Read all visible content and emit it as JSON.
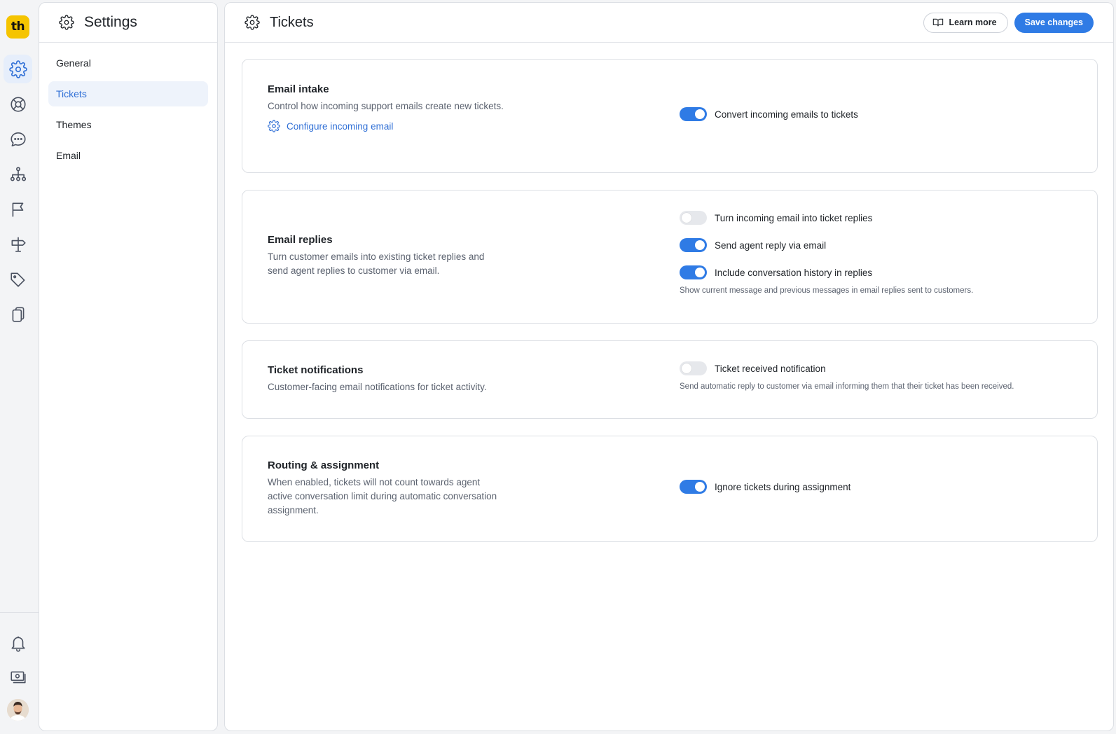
{
  "brand": {
    "logo_text": "th",
    "accent": "#2f7be5",
    "logo_color": "#f5c400"
  },
  "rail": {
    "items": [
      {
        "name": "settings-icon",
        "active": true
      },
      {
        "name": "lifebuoy-icon",
        "active": false
      },
      {
        "name": "chat-icon",
        "active": false
      },
      {
        "name": "org-chart-icon",
        "active": false
      },
      {
        "name": "flag-icon",
        "active": false
      },
      {
        "name": "signpost-icon",
        "active": false
      },
      {
        "name": "tag-icon",
        "active": false
      },
      {
        "name": "pages-icon",
        "active": false
      }
    ],
    "bottom": [
      "bell-icon",
      "billing-icon",
      "avatar"
    ]
  },
  "subnav": {
    "title": "Settings",
    "items": [
      {
        "label": "General",
        "active": false
      },
      {
        "label": "Tickets",
        "active": true
      },
      {
        "label": "Themes",
        "active": false
      },
      {
        "label": "Email",
        "active": false
      }
    ]
  },
  "main": {
    "title": "Tickets",
    "learn_more_label": "Learn more",
    "save_label": "Save changes"
  },
  "sections": {
    "email_intake": {
      "title": "Email intake",
      "description": "Control how incoming support emails create new tickets.",
      "link_label": "Configure incoming email",
      "toggles": [
        {
          "label": "Convert incoming emails to tickets",
          "on": true
        }
      ]
    },
    "email_replies": {
      "title": "Email replies",
      "description": "Turn customer emails into existing ticket replies and send agent replies to customer via email.",
      "toggles": [
        {
          "label": "Turn incoming email into ticket replies",
          "on": false
        },
        {
          "label": "Send agent reply via email",
          "on": true
        },
        {
          "label": "Include conversation history in replies",
          "on": true
        }
      ],
      "help": "Show current message and previous messages in email replies sent to customers."
    },
    "ticket_notifications": {
      "title": "Ticket notifications",
      "description": "Customer-facing email notifications for ticket activity.",
      "toggles": [
        {
          "label": "Ticket received notification",
          "on": false
        }
      ],
      "help": "Send automatic reply to customer via email informing them that their ticket has been received."
    },
    "routing": {
      "title": "Routing & assignment",
      "description": "When enabled, tickets will not count towards agent active conversation limit during automatic conversation assignment.",
      "toggles": [
        {
          "label": "Ignore tickets during assignment",
          "on": true
        }
      ]
    }
  }
}
